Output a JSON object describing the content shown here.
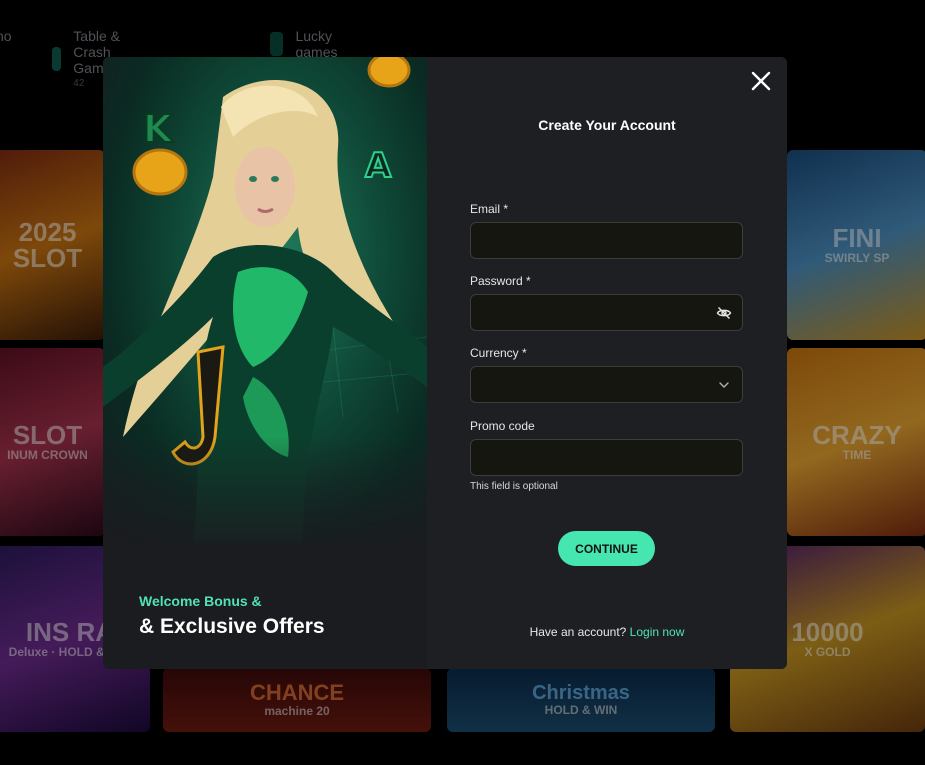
{
  "background": {
    "nav": [
      {
        "label": "no",
        "sub": ""
      },
      {
        "label": "Table & Crash Games",
        "sub": "42"
      },
      {
        "label": "Lucky games",
        "sub": ""
      }
    ],
    "tiles": [
      {
        "title": "2025 SLOT",
        "sub": ""
      },
      {
        "title": "SLOT",
        "sub": "INUM CROWN"
      },
      {
        "title": "INS RA",
        "sub": "Deluxe · HOLD & WIN"
      },
      {
        "title": "CHANCE",
        "sub": "machine 20"
      },
      {
        "title": "Christmas",
        "sub": "HOLD & WIN"
      },
      {
        "title": "FINI",
        "sub": "SWIRLY SP"
      },
      {
        "title": "CRAZY",
        "sub": "TIME"
      },
      {
        "title": "10000",
        "sub": "X GOLD"
      }
    ]
  },
  "modal": {
    "promo": {
      "kicker": "Welcome Bonus &",
      "title": "& Exclusive Offers"
    },
    "form": {
      "title": "Create Your Account",
      "email_label": "Email *",
      "email_value": "",
      "password_label": "Password *",
      "password_value": "",
      "currency_label": "Currency *",
      "currency_value": "",
      "promo_label": "Promo code",
      "promo_value": "",
      "promo_hint": "This field is optional",
      "continue_label": "CONTINUE",
      "login_prompt": "Have an account?",
      "login_link": "Login now"
    },
    "icons": {
      "close": "close-icon",
      "password_toggle": "eye-off-icon",
      "currency_dropdown": "chevron-down-icon"
    },
    "colors": {
      "accent": "#46e6b0",
      "modal_bg": "#1e1f23",
      "input_bg": "#15160f"
    }
  }
}
